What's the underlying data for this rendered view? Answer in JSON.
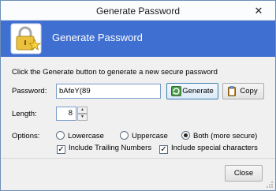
{
  "window": {
    "title": "Generate Password",
    "close_glyph": "✕"
  },
  "header": {
    "title": "Generate Password",
    "logo_icon": "padlock-star-icon"
  },
  "instructions": "Click the Generate button to generate a new secure password",
  "password": {
    "label": "Password:",
    "value": "bAfeY(89"
  },
  "buttons": {
    "generate": "Generate",
    "copy": "Copy",
    "close": "Close"
  },
  "length": {
    "label": "Length:",
    "value": "8"
  },
  "options": {
    "label": "Options:",
    "radios": [
      {
        "label": "Lowercase",
        "selected": false
      },
      {
        "label": "Uppercase",
        "selected": false
      },
      {
        "label": "Both (more secure)",
        "selected": true
      }
    ],
    "checkboxes": [
      {
        "label": "Include Trailing Numbers",
        "checked": true
      },
      {
        "label": "Include special characters",
        "checked": true
      }
    ]
  },
  "colors": {
    "header_bg": "#3f6fd0",
    "window_border": "#6c8fb6"
  }
}
